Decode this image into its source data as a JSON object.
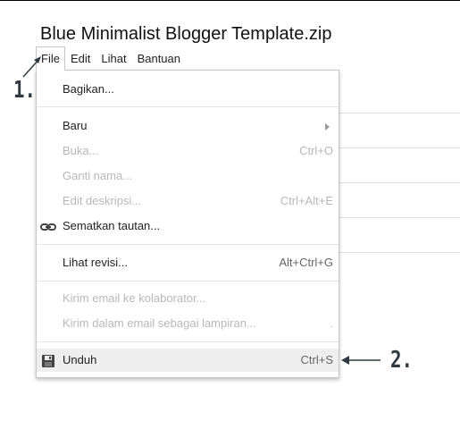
{
  "document": {
    "title": "Blue Minimalist Blogger Template.zip"
  },
  "menubar": {
    "items": [
      {
        "label": "File"
      },
      {
        "label": "Edit"
      },
      {
        "label": "Lihat"
      },
      {
        "label": "Bantuan"
      }
    ]
  },
  "file_menu": {
    "share": {
      "label": "Bagikan..."
    },
    "new": {
      "label": "Baru"
    },
    "open": {
      "label": "Buka...",
      "shortcut": "Ctrl+O"
    },
    "rename": {
      "label": "Ganti nama..."
    },
    "edit_description": {
      "label": "Edit deskripsi...",
      "shortcut": "Ctrl+Alt+E"
    },
    "embed_link": {
      "label": "Sematkan tautan..."
    },
    "revisions": {
      "label": "Lihat revisi...",
      "shortcut": "Alt+Ctrl+G"
    },
    "email_collaborators": {
      "label": "Kirim email ke kolaborator..."
    },
    "email_attachment": {
      "label": "Kirim dalam email sebagai lampiran...",
      "shortcut": "."
    },
    "download": {
      "label": "Unduh",
      "shortcut": "Ctrl+S"
    }
  },
  "annotations": {
    "step1": "1.",
    "step2": "2."
  },
  "colors": {
    "disabled_text": "#b8b8b8",
    "highlight_bg": "#eeeeee",
    "annotation": "#2f3a40"
  },
  "icons": {
    "embed_link": "link-icon",
    "download": "save-icon",
    "new": "submenu-arrow-icon"
  }
}
